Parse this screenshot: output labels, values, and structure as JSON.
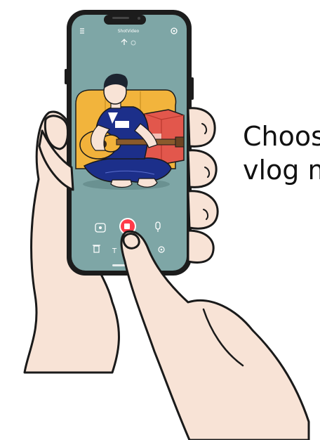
{
  "caption": {
    "line1": "Choos",
    "line2": "vlog m"
  },
  "phone": {
    "app_title": "ShotVideo",
    "icons": {
      "menu": "menu-icon",
      "settings": "gear-icon",
      "flip": "flip-icon",
      "effects": "effects-icon",
      "record": "record-icon",
      "mic": "mic-icon",
      "delete": "trash-icon",
      "text": "text-icon",
      "more": "more-icon"
    }
  },
  "colors": {
    "screen_bg": "#7ea6a6",
    "record_button": "#ff3b4a",
    "skin": "#f8e3d6",
    "guitar": "#f2b23b",
    "sofa": "#f2b43c",
    "pillow": "#e2574c",
    "shirt": "#1c2f8a"
  }
}
